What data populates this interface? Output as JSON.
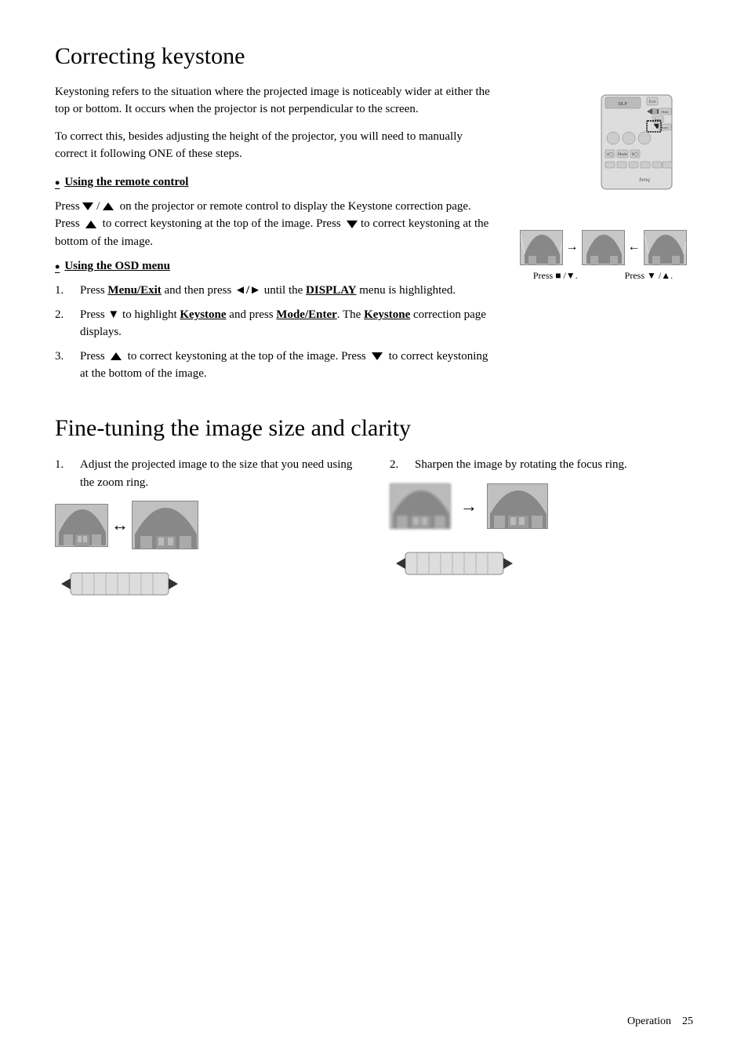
{
  "page": {
    "sections": [
      {
        "id": "correcting-keystone",
        "title": "Correcting keystone",
        "intro1": "Keystoning refers to the situation where the projected image is noticeably wider at either the top or bottom. It occurs when the projector is not perpendicular to the screen.",
        "intro2": "To correct this, besides adjusting the height of the projector, you will need to manually correct it following ONE of these steps.",
        "bullet1": {
          "heading": "Using the remote control",
          "text1": "Press",
          "icon1": "triangle-down",
          "slash": " / ",
          "icon2": "triangle-up",
          "text2": " on the projector or remote control to display the Keystone correction page. Press ",
          "icon3": "triangle-up",
          "text3": " to correct keystoning at the top of the image. Press ",
          "icon4": "triangle-down",
          "text4": " to correct keystoning at the bottom of the image."
        },
        "bullet2": {
          "heading": "Using the OSD menu",
          "steps": [
            {
              "num": "1.",
              "text": "Press Menu/Exit and then press ◄/► until the DISPLAY menu is highlighted."
            },
            {
              "num": "2.",
              "text": "Press ▼ to highlight Keystone and press Mode/Enter. The Keystone correction page displays."
            },
            {
              "num": "3.",
              "text": "Press ▲ to correct keystoning at the top of the image. Press ▼ to correct keystoning at the bottom of the image."
            }
          ]
        },
        "press_label1": "Press ■ /▼.",
        "press_label2": "Press ▼ /▲."
      },
      {
        "id": "fine-tuning",
        "title": "Fine-tuning the image size and clarity",
        "item1": {
          "num": "1.",
          "text": "Adjust the projected image to the size that you need using the zoom ring."
        },
        "item2": {
          "num": "2.",
          "text": "Sharpen the image by rotating the focus ring."
        }
      }
    ],
    "footer": {
      "text": "Operation",
      "page_num": "25"
    }
  }
}
